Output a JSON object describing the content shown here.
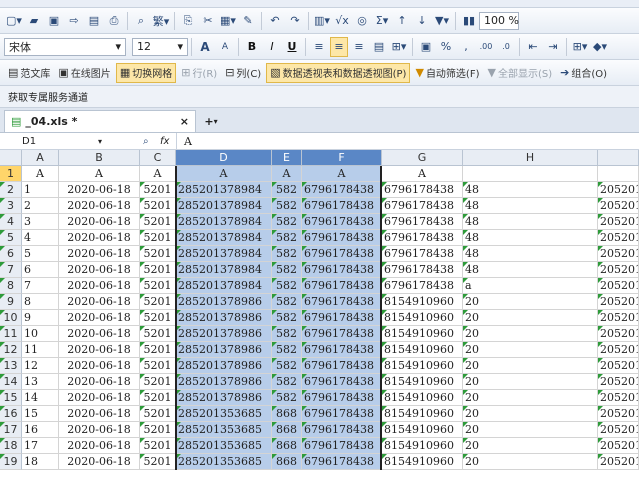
{
  "toolbar1": {
    "zoom": "100 %",
    "sigma": "Σ"
  },
  "toolbar2": {
    "font_name": "宋体",
    "font_size": "12",
    "bold": "B",
    "italic": "I",
    "underline": "U",
    "grow_font": "A",
    "shrink_font": "A",
    "percent": "%"
  },
  "toolbar3": {
    "items": [
      {
        "label": "范文库",
        "icon": "▤"
      },
      {
        "label": "在线图片",
        "icon": "▣"
      },
      {
        "label": "切换网格",
        "icon": "▦"
      },
      {
        "label": "行(R)",
        "icon": "⊞"
      },
      {
        "label": "列(C)",
        "icon": "⊟"
      },
      {
        "label": "数据透视表和数据透视图(P)",
        "icon": "▧"
      },
      {
        "label": "自动筛选(F)",
        "icon": "▼"
      },
      {
        "label": "全部显示(S)",
        "icon": "▼"
      },
      {
        "label": "组合(O)",
        "icon": "➔"
      }
    ]
  },
  "channel": {
    "label": "获取专属服务通道"
  },
  "tab": {
    "file_name": "_04.xls *",
    "close": "×",
    "add": "+"
  },
  "formula": {
    "cell_ref": "D1",
    "fx": "fx",
    "value": "A"
  },
  "grid": {
    "columns": [
      "A",
      "B",
      "C",
      "D",
      "E",
      "F",
      "G",
      "H"
    ],
    "header_row": [
      "A",
      "A",
      "A",
      "A",
      "A",
      "A",
      "A",
      ""
    ],
    "rows": [
      {
        "n": "2",
        "a": "1",
        "b": "2020-06-18",
        "c": "5201",
        "d": "285201378984",
        "e": "582",
        "f": "6796178438",
        "g": "6796178438",
        "h": "48",
        "i": "205201"
      },
      {
        "n": "3",
        "a": "2",
        "b": "2020-06-18",
        "c": "5201",
        "d": "285201378984",
        "e": "582",
        "f": "6796178438",
        "g": "6796178438",
        "h": "48",
        "i": "205201"
      },
      {
        "n": "4",
        "a": "3",
        "b": "2020-06-18",
        "c": "5201",
        "d": "285201378984",
        "e": "582",
        "f": "6796178438",
        "g": "6796178438",
        "h": "48",
        "i": "205201"
      },
      {
        "n": "5",
        "a": "4",
        "b": "2020-06-18",
        "c": "5201",
        "d": "285201378984",
        "e": "582",
        "f": "6796178438",
        "g": "6796178438",
        "h": "48",
        "i": "205201"
      },
      {
        "n": "6",
        "a": "5",
        "b": "2020-06-18",
        "c": "5201",
        "d": "285201378984",
        "e": "582",
        "f": "6796178438",
        "g": "6796178438",
        "h": "48",
        "i": "205201"
      },
      {
        "n": "7",
        "a": "6",
        "b": "2020-06-18",
        "c": "5201",
        "d": "285201378984",
        "e": "582",
        "f": "6796178438",
        "g": "6796178438",
        "h": "48",
        "i": "205201"
      },
      {
        "n": "8",
        "a": "7",
        "b": "2020-06-18",
        "c": "5201",
        "d": "285201378984",
        "e": "582",
        "f": "6796178438",
        "g": "6796178438",
        "h": "a",
        "i": "205201"
      },
      {
        "n": "9",
        "a": "8",
        "b": "2020-06-18",
        "c": "5201",
        "d": "285201378986",
        "e": "582",
        "f": "6796178438",
        "g": "8154910960",
        "h": "20",
        "i": "205201"
      },
      {
        "n": "10",
        "a": "9",
        "b": "2020-06-18",
        "c": "5201",
        "d": "285201378986",
        "e": "582",
        "f": "6796178438",
        "g": "8154910960",
        "h": "20",
        "i": "205201"
      },
      {
        "n": "11",
        "a": "10",
        "b": "2020-06-18",
        "c": "5201",
        "d": "285201378986",
        "e": "582",
        "f": "6796178438",
        "g": "8154910960",
        "h": "20",
        "i": "205201"
      },
      {
        "n": "12",
        "a": "11",
        "b": "2020-06-18",
        "c": "5201",
        "d": "285201378986",
        "e": "582",
        "f": "6796178438",
        "g": "8154910960",
        "h": "20",
        "i": "205201"
      },
      {
        "n": "13",
        "a": "12",
        "b": "2020-06-18",
        "c": "5201",
        "d": "285201378986",
        "e": "582",
        "f": "6796178438",
        "g": "8154910960",
        "h": "20",
        "i": "205201"
      },
      {
        "n": "14",
        "a": "13",
        "b": "2020-06-18",
        "c": "5201",
        "d": "285201378986",
        "e": "582",
        "f": "6796178438",
        "g": "8154910960",
        "h": "20",
        "i": "205201"
      },
      {
        "n": "15",
        "a": "14",
        "b": "2020-06-18",
        "c": "5201",
        "d": "285201378986",
        "e": "582",
        "f": "6796178438",
        "g": "8154910960",
        "h": "20",
        "i": "205201"
      },
      {
        "n": "16",
        "a": "15",
        "b": "2020-06-18",
        "c": "5201",
        "d": "285201353685",
        "e": "868",
        "f": "6796178438",
        "g": "8154910960",
        "h": "20",
        "i": "205201"
      },
      {
        "n": "17",
        "a": "16",
        "b": "2020-06-18",
        "c": "5201",
        "d": "285201353685",
        "e": "868",
        "f": "6796178438",
        "g": "8154910960",
        "h": "20",
        "i": "205201"
      },
      {
        "n": "18",
        "a": "17",
        "b": "2020-06-18",
        "c": "5201",
        "d": "285201353685",
        "e": "868",
        "f": "6796178438",
        "g": "8154910960",
        "h": "20",
        "i": "205201"
      },
      {
        "n": "19",
        "a": "18",
        "b": "2020-06-18",
        "c": "5201",
        "d": "285201353685",
        "e": "868",
        "f": "6796178438",
        "g": "8154910960",
        "h": "20",
        "i": "205201"
      }
    ]
  }
}
